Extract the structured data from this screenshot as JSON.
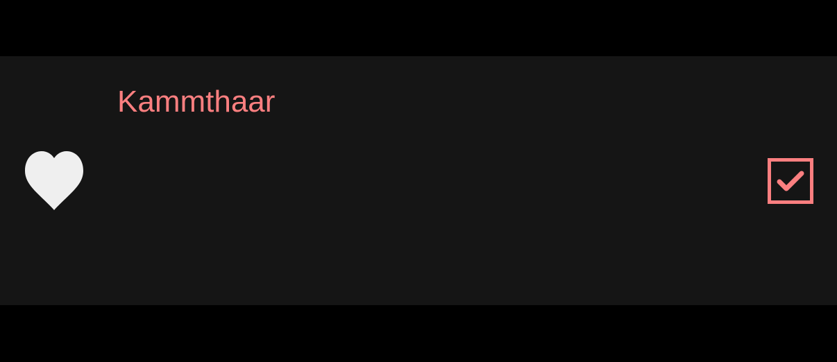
{
  "item": {
    "title": "Kammthaar",
    "favorite_icon": "heart-icon",
    "checked": true,
    "check_icon": "checkmark-icon"
  },
  "colors": {
    "background": "#000000",
    "row_background": "#151515",
    "accent": "#fb7f80",
    "icon": "#efefef"
  }
}
